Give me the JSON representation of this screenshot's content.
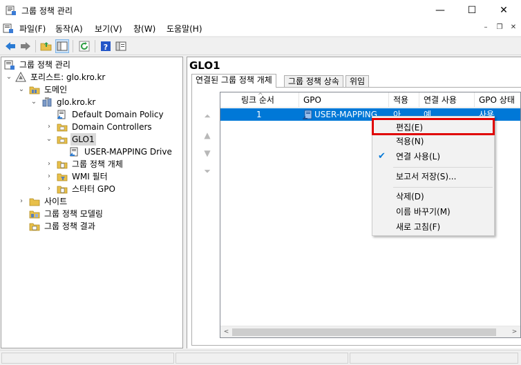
{
  "window": {
    "title": "그룹 정책 관리",
    "minimize": "—",
    "maximize": "☐",
    "close": "✕"
  },
  "menu": {
    "items": [
      "파일(F)",
      "동작(A)",
      "보기(V)",
      "창(W)",
      "도움말(H)"
    ],
    "mdi_minimize": "–",
    "mdi_restore": "❐",
    "mdi_close": "✕"
  },
  "toolbar": {
    "icons": [
      "back-icon",
      "forward-icon",
      "up-folder-icon",
      "show-hide-tree-icon",
      "refresh-icon",
      "help-icon",
      "properties-icon"
    ]
  },
  "tree": {
    "root": "그룹 정책 관리",
    "forest": "포리스트: glo.kro.kr",
    "domains": "도메인",
    "domain": "glo.kro.kr",
    "default_policy": "Default Domain Policy",
    "domain_controllers": "Domain Controllers",
    "ou": "GLO1",
    "ou_link": "USER-MAPPING Drive",
    "gpo_objects": "그룹 정책 개체",
    "wmi_filters": "WMI 필터",
    "starter_gpo": "스타터 GPO",
    "sites": "사이트",
    "modeling": "그룹 정책 모델링",
    "results": "그룹 정책 결과"
  },
  "right": {
    "title": "GLO1",
    "tabs": [
      "연결된 그룹 정책 개체",
      "그룹 정책 상속",
      "위임"
    ],
    "columns": [
      "링크 순서",
      "GPO",
      "적용",
      "연결 사용",
      "GPO 상태"
    ],
    "rows": [
      {
        "order": "1",
        "gpo": "USER-MAPPING",
        "enforced": "아",
        "link_enabled": "예",
        "status": "사용"
      }
    ]
  },
  "context_menu": {
    "items": [
      "편집(E)",
      "적용(N)",
      "연결 사용(L)",
      "보고서 저장(S)...",
      "삭제(D)",
      "이름 바꾸기(M)",
      "새로 고침(F)"
    ],
    "checked": "연결 사용(L)"
  },
  "colors": {
    "selection": "#0078d7",
    "highlight_box": "#e00000"
  }
}
